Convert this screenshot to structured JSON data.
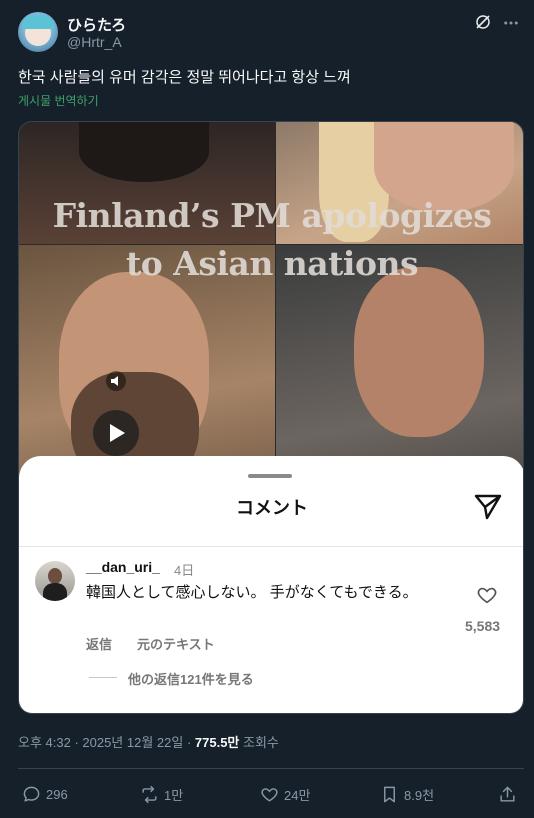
{
  "user": {
    "display_name": "ひらたろ",
    "handle": "@Hrtr_A"
  },
  "tweet": {
    "text": "한국 사람들의 유머 감각은 정말 뛰어나다고 항상 느껴",
    "translate_label": "게시물 번역하기"
  },
  "media": {
    "overlay_title_line1": "Finland’s PM apologizes",
    "overlay_title_line2": "to Asian nations"
  },
  "comments_sheet": {
    "title": "コメント",
    "comment": {
      "username": "__dan_uri_",
      "time": "4日",
      "text": "韓国人として感心しない。 手がなくてもできる。",
      "likes": "5,583",
      "reply_label": "返信",
      "original_text_label": "元のテキスト",
      "more_replies_label": "他の返信121件を見る"
    }
  },
  "meta": {
    "time_date": "오후 4:32 · 2025년 12월 22일 · ",
    "views_value": "775.5만",
    "views_label": " 조회수"
  },
  "actions": {
    "replies": "296",
    "reposts": "1만",
    "likes": "24만",
    "bookmarks": "8.9천"
  },
  "colors": {
    "background": "#15202b",
    "link": "#1d9bf0",
    "muted": "#8b98a5"
  }
}
